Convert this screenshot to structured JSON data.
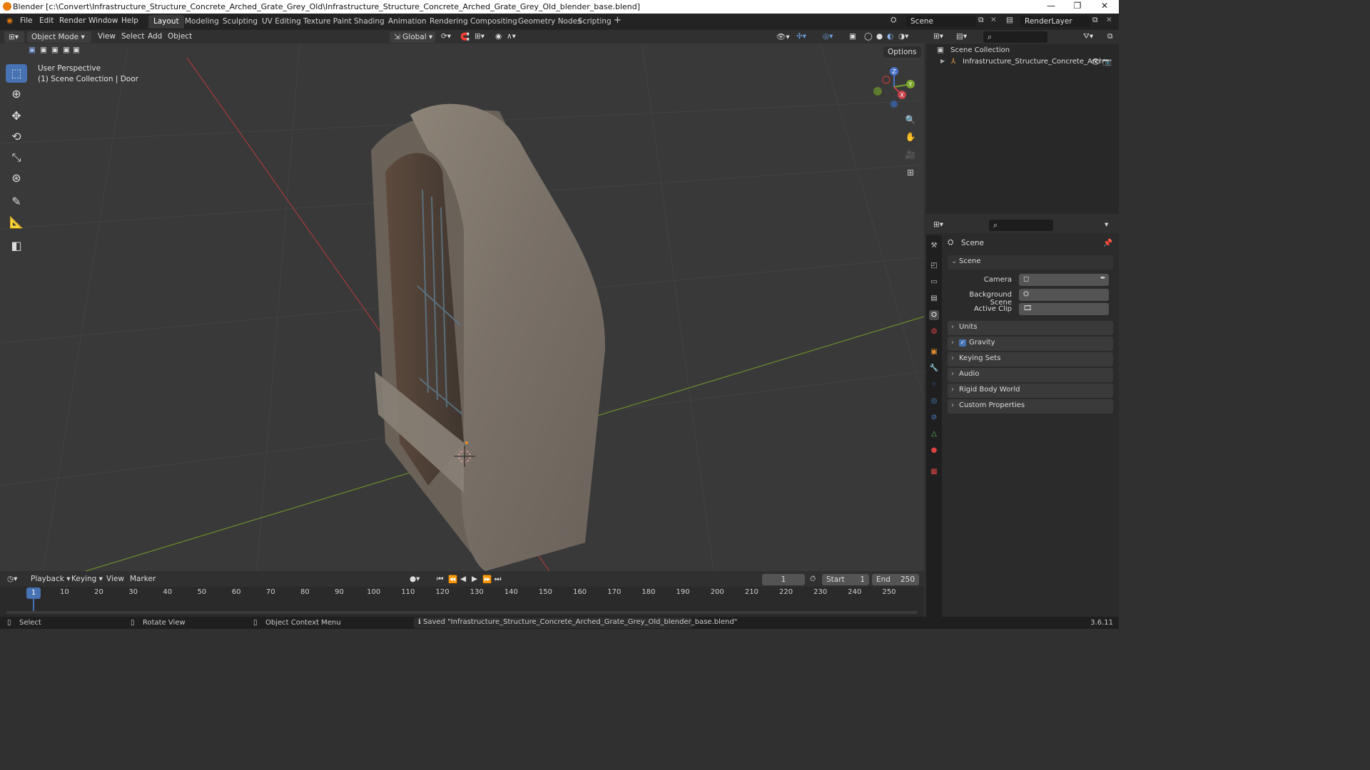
{
  "window": {
    "title": "Blender [c:\\Convert\\Infrastructure_Structure_Concrete_Arched_Grate_Grey_Old\\Infrastructure_Structure_Concrete_Arched_Grate_Grey_Old_blender_base.blend]",
    "controls": {
      "minimize": "—",
      "maximize": "❐",
      "close": "✕"
    }
  },
  "menubar": {
    "items": [
      "File",
      "Edit",
      "Render",
      "Window",
      "Help"
    ],
    "workspaces": [
      "Layout",
      "Modeling",
      "Sculpting",
      "UV Editing",
      "Texture Paint",
      "Shading",
      "Animation",
      "Rendering",
      "Compositing",
      "Geometry Nodes",
      "Scripting"
    ],
    "active_workspace": "Layout",
    "add_workspace": "+",
    "scene": "Scene",
    "view_layer": "RenderLayer"
  },
  "viewport_header": {
    "mode": "Object Mode",
    "menus": [
      "View",
      "Select",
      "Add",
      "Object"
    ],
    "orientation": "Global",
    "options": "Options"
  },
  "viewport": {
    "perspective": "User Perspective",
    "context": "(1) Scene Collection | Door",
    "gizmo": {
      "z": "Z",
      "y": "Y",
      "x": "X"
    },
    "colors": {
      "x_axis": "#a63a3a",
      "y_axis": "#6b8f2b",
      "background": "#393939"
    }
  },
  "toolbar": {
    "tools": [
      "select-box",
      "cursor",
      "move",
      "rotate",
      "scale",
      "transform",
      "annotate",
      "measure",
      "add-cube"
    ],
    "active": "select-box"
  },
  "outliner": {
    "root": "Scene Collection",
    "items": [
      {
        "label": "Infrastructure_Structure_Concrete_Arch"
      }
    ]
  },
  "properties": {
    "context": "Scene",
    "section": "Scene",
    "fields": [
      {
        "label": "Camera",
        "value": ""
      },
      {
        "label": "Background Scene",
        "value": ""
      },
      {
        "label": "Active Clip",
        "value": ""
      }
    ],
    "panels": [
      "Units",
      "Gravity",
      "Keying Sets",
      "Audio",
      "Rigid Body World",
      "Custom Properties"
    ],
    "gravity_enabled": true
  },
  "timeline": {
    "menus": [
      "Playback",
      "Keying",
      "View",
      "Marker"
    ],
    "current_frame": "1",
    "start_label": "Start",
    "start": "1",
    "end_label": "End",
    "end": "250",
    "ticks": [
      "1",
      "10",
      "20",
      "30",
      "40",
      "50",
      "60",
      "70",
      "80",
      "90",
      "100",
      "110",
      "120",
      "130",
      "140",
      "150",
      "160",
      "170",
      "180",
      "190",
      "200",
      "210",
      "220",
      "230",
      "240",
      "250"
    ]
  },
  "statusbar": {
    "select": "Select",
    "rotate": "Rotate View",
    "context_menu": "Object Context Menu",
    "message": "Saved \"Infrastructure_Structure_Concrete_Arched_Grate_Grey_Old_blender_base.blend\"",
    "version": "3.6.11"
  }
}
